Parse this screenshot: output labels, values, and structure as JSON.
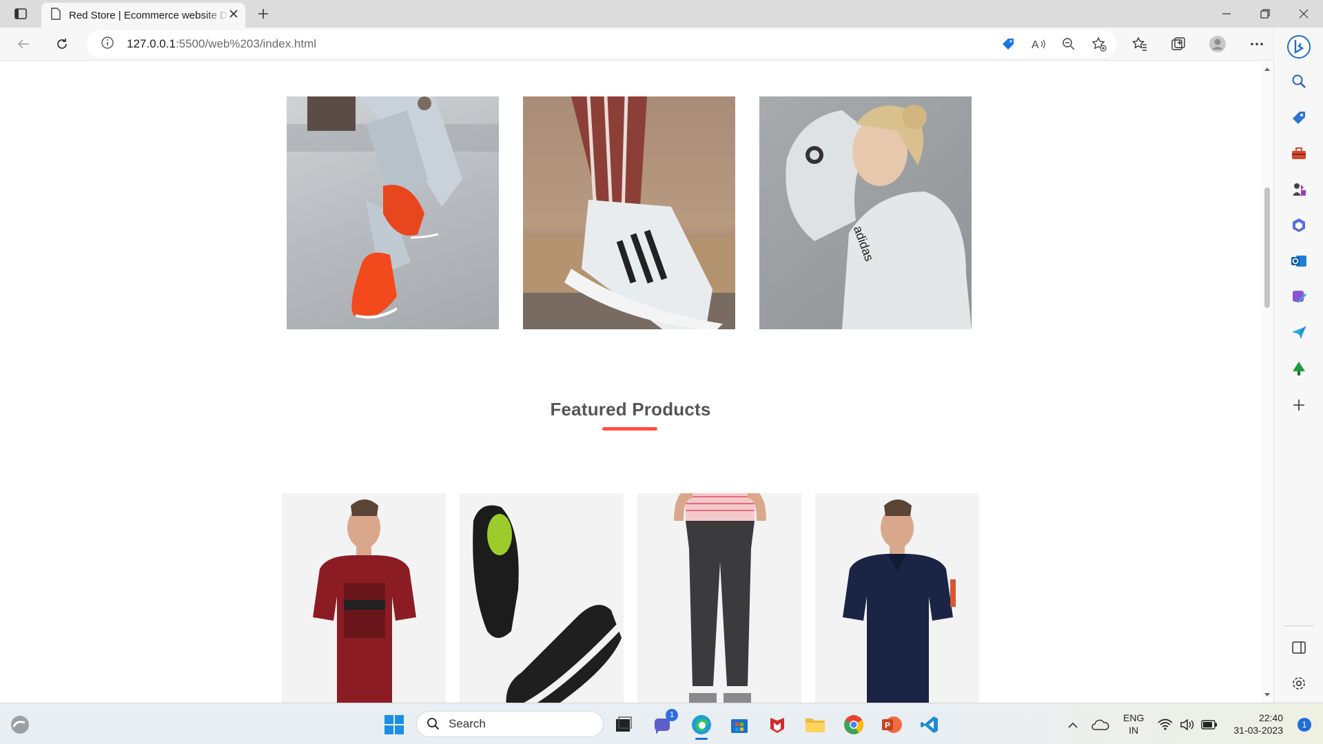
{
  "browser": {
    "tab_title": "Red Store | Ecommerce website D",
    "url_host": "127.0.0.1",
    "url_rest": ":5500/web%203/index.html"
  },
  "page": {
    "featured_title": "Featured Products",
    "accent_color": "#ff523b"
  },
  "categories": [
    {
      "icon": "orange-sneakers-photo"
    },
    {
      "icon": "striped-sneaker-photo"
    },
    {
      "icon": "woman-hoodie-photo"
    }
  ],
  "products": [
    {
      "icon": "red-tshirt-photo"
    },
    {
      "icon": "black-shoes-photo"
    },
    {
      "icon": "grey-joggers-photo"
    },
    {
      "icon": "navy-polo-photo"
    }
  ],
  "taskbar": {
    "search_label": "Search",
    "chat_badge": "1",
    "lang_line1": "ENG",
    "lang_line2": "IN",
    "time": "22:40",
    "date": "31-03-2023",
    "notif_count": "1"
  }
}
